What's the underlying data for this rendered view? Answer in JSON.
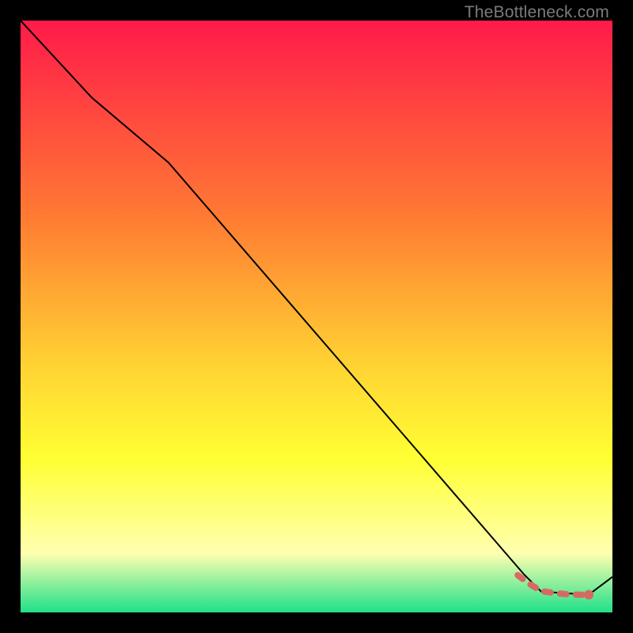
{
  "watermark": "TheBottleneck.com",
  "colors": {
    "top": "#ff1a4a",
    "mid1": "#ff7a33",
    "mid2": "#ffd233",
    "mid3": "#ffff33",
    "low": "#ffffb0",
    "bottom": "#1fe08a",
    "line": "#000000",
    "dash": "#d66a63",
    "marker": "#d66a63"
  },
  "chart_data": {
    "type": "line",
    "title": "",
    "xlabel": "",
    "ylabel": "",
    "xlim": [
      0,
      100
    ],
    "ylim": [
      0,
      100
    ],
    "series": [
      {
        "name": "main-curve",
        "x": [
          0,
          12,
          25,
          85,
          88,
          96,
          100
        ],
        "y": [
          100,
          87,
          76,
          6.5,
          3.5,
          3,
          6
        ]
      },
      {
        "name": "optimum-band",
        "style": "dashed-with-marker",
        "x": [
          84,
          86,
          88,
          90,
          92,
          94,
          96
        ],
        "y": [
          6.3,
          4.8,
          3.6,
          3.3,
          3.1,
          3.0,
          3.0
        ]
      }
    ],
    "annotations": []
  }
}
